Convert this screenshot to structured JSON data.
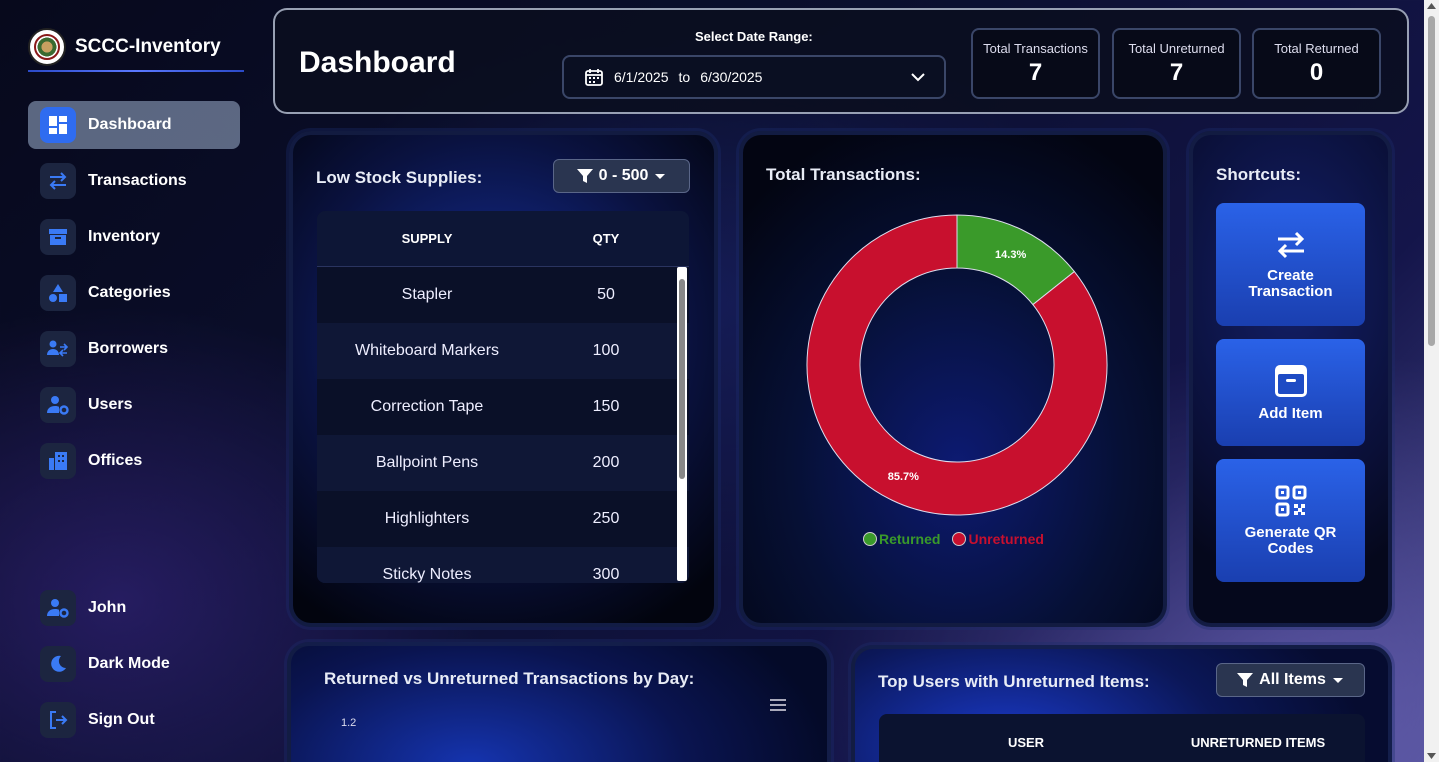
{
  "app": {
    "name": "SCCC-Inventory"
  },
  "sidebar": {
    "items": [
      {
        "label": "Dashboard",
        "icon": "dashboard-icon",
        "active": true
      },
      {
        "label": "Transactions",
        "icon": "transfer-arrows-icon"
      },
      {
        "label": "Inventory",
        "icon": "archive-box-icon"
      },
      {
        "label": "Categories",
        "icon": "shapes-icon"
      },
      {
        "label": "Borrowers",
        "icon": "users-exchange-icon"
      },
      {
        "label": "Users",
        "icon": "user-gear-icon"
      },
      {
        "label": "Offices",
        "icon": "building-icon"
      }
    ],
    "bottom": [
      {
        "label": "John",
        "icon": "user-gear-icon"
      },
      {
        "label": "Dark Mode",
        "icon": "moon-icon"
      },
      {
        "label": "Sign Out",
        "icon": "sign-out-icon"
      }
    ]
  },
  "header": {
    "title": "Dashboard",
    "date_label": "Select Date Range:",
    "date_start": "6/1/2025",
    "date_to": "to",
    "date_end": "6/30/2025",
    "stats": [
      {
        "label": "Total Transactions",
        "value": "7"
      },
      {
        "label": "Total Unreturned",
        "value": "7"
      },
      {
        "label": "Total Returned",
        "value": "0"
      }
    ]
  },
  "low_stock": {
    "title": "Low Stock Supplies:",
    "filter": "0 - 500",
    "columns": [
      "SUPPLY",
      "QTY"
    ],
    "rows": [
      [
        "Stapler",
        "50"
      ],
      [
        "Whiteboard Markers",
        "100"
      ],
      [
        "Correction Tape",
        "150"
      ],
      [
        "Ballpoint Pens",
        "200"
      ],
      [
        "Highlighters",
        "250"
      ],
      [
        "Sticky Notes",
        "300"
      ]
    ]
  },
  "total_transactions": {
    "title": "Total Transactions:",
    "legend": [
      "Returned",
      "Unreturned"
    ]
  },
  "chart_data": {
    "type": "pie",
    "title": "Total Transactions:",
    "categories": [
      "Returned",
      "Unreturned"
    ],
    "values": [
      14.3,
      85.7
    ],
    "labels": [
      "14.3%",
      "85.7%"
    ],
    "colors": [
      "#3a9a2a",
      "#c8102e"
    ],
    "legend_position": "bottom",
    "donut": true
  },
  "shortcuts": {
    "title": "Shortcuts:",
    "items": [
      {
        "label": "Create Transaction",
        "icon": "transfer-arrows-icon"
      },
      {
        "label": "Add Item",
        "icon": "archive-box-icon"
      },
      {
        "label": "Generate QR Codes",
        "icon": "qr-code-icon"
      }
    ]
  },
  "by_day": {
    "title": "Returned vs Unreturned Transactions by Day:",
    "y_tick": "1.2"
  },
  "top_users": {
    "title": "Top Users with Unreturned Items:",
    "filter": "All Items",
    "columns": [
      "USER",
      "UNRETURNED ITEMS"
    ]
  }
}
